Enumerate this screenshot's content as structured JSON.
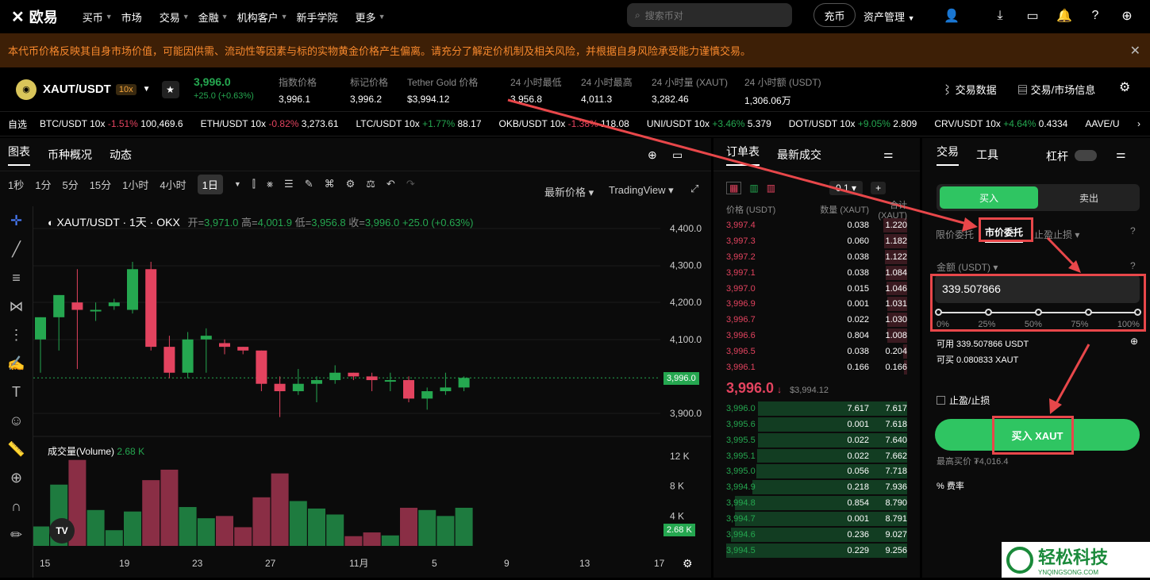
{
  "nav": {
    "logo": "欧易",
    "items": [
      "买币",
      "市场",
      "交易",
      "金融",
      "机构客户",
      "新手学院",
      "更多"
    ],
    "search_placeholder": "搜索币对",
    "deposit": "充币",
    "asset": "资产管理"
  },
  "banner": {
    "text": "本代币价格反映其自身市场价值，可能因供需、流动性等因素与标的实物黄金价格产生偏离。请充分了解定价机制及相关风险，并根据自身风险承受能力谨慎交易。"
  },
  "ticker": {
    "pair": "XAUT/USDT",
    "lev": "10x",
    "price": "3,996.0",
    "change": "+25.0 (+0.63%)",
    "stats": [
      {
        "l": "指数价格",
        "v": "3,996.1"
      },
      {
        "l": "标记价格",
        "v": "3,996.2"
      },
      {
        "l": "Tether Gold 价格",
        "v": "$3,994.12"
      },
      {
        "l": "24 小时最低",
        "v": "3,956.8"
      },
      {
        "l": "24 小时最高",
        "v": "4,011.3"
      },
      {
        "l": "24 小时量 (XAUT)",
        "v": "3,282.46"
      },
      {
        "l": "24 小时额 (USDT)",
        "v": "1,306.06万"
      }
    ],
    "data_btn": "交易数据",
    "info_btn": "交易/市场信息"
  },
  "watch": {
    "label": "自选",
    "items": [
      {
        "p": "BTC/USDT 10x",
        "c": "-1.51%",
        "v": "100,469.6",
        "up": false
      },
      {
        "p": "ETH/USDT 10x",
        "c": "-0.82%",
        "v": "3,273.61",
        "up": false
      },
      {
        "p": "LTC/USDT 10x",
        "c": "+1.77%",
        "v": "88.17",
        "up": true
      },
      {
        "p": "OKB/USDT 10x",
        "c": "-1.38%",
        "v": "118.08",
        "up": false
      },
      {
        "p": "UNI/USDT 10x",
        "c": "+3.46%",
        "v": "5.379",
        "up": true
      },
      {
        "p": "DOT/USDT 10x",
        "c": "+9.05%",
        "v": "2.809",
        "up": true
      },
      {
        "p": "CRV/USDT 10x",
        "c": "+4.64%",
        "v": "0.4334",
        "up": true
      },
      {
        "p": "AAVE/U",
        "c": "",
        "v": "",
        "up": true
      }
    ]
  },
  "chart": {
    "tabs": [
      "图表",
      "币种概况",
      "动态"
    ],
    "tf": [
      "1秒",
      "1分",
      "5分",
      "15分",
      "1小时",
      "4小时",
      "1日"
    ],
    "price_type": "最新价格",
    "view": "TradingView",
    "legend": {
      "title": "XAUT/USDT · 1天 · OKX",
      "o": "3,971.0",
      "h": "4,001.9",
      "l": "3,956.8",
      "c": "3,996.0",
      "ch": "+25.0 (+0.63%)"
    },
    "vol_label": "成交量(Volume)",
    "vol_val": "2.68 K",
    "last_label": "3,996.0",
    "vol_last": "2.68 K"
  },
  "chart_data": {
    "type": "candlestick",
    "title": "XAUT/USDT · 1天 · OKX",
    "y_ticks": [
      "4,400.0",
      "4,300.0",
      "4,200.0",
      "4,100.0",
      "3,900.0"
    ],
    "vol_ticks": [
      "12 K",
      "8 K",
      "4 K"
    ],
    "x_ticks": [
      "15",
      "19",
      "23",
      "27",
      "11月",
      "5",
      "9",
      "13",
      "17"
    ],
    "candles": [
      [
        4100,
        4160,
        4020,
        4010
      ],
      [
        4160,
        4220,
        4110,
        4070
      ],
      [
        4200,
        4180,
        4290,
        4020
      ],
      [
        4180,
        4180,
        4200,
        4150
      ],
      [
        4190,
        4200,
        4210,
        4180
      ],
      [
        4180,
        4290,
        4310,
        4170
      ],
      [
        4290,
        4080,
        4310,
        4070
      ],
      [
        4080,
        4010,
        4110,
        3995
      ],
      [
        4010,
        4100,
        4120,
        3995
      ],
      [
        4100,
        4110,
        4130,
        4010
      ],
      [
        4090,
        4080,
        4100,
        4060
      ],
      [
        4080,
        4070,
        4080,
        4060
      ],
      [
        4070,
        3980,
        4070,
        3960
      ],
      [
        3980,
        3960,
        4000,
        3890
      ],
      [
        3960,
        3980,
        4020,
        3950
      ],
      [
        3980,
        3990,
        4000,
        3930
      ],
      [
        3990,
        4010,
        4030,
        3980
      ],
      [
        4010,
        4000,
        4010,
        3990
      ],
      [
        4000,
        3990,
        4010,
        3960
      ],
      [
        3990,
        3990,
        4010,
        3960
      ],
      [
        3990,
        3940,
        4000,
        3930
      ],
      [
        3940,
        3960,
        3970,
        3910
      ],
      [
        3960,
        3970,
        4010,
        3950
      ],
      [
        3970,
        3996,
        4000,
        3960
      ]
    ],
    "volumes": [
      2600,
      8200,
      11500,
      4800,
      2100,
      4600,
      8800,
      10200,
      5200,
      3700,
      4000,
      2500,
      6500,
      9700,
      6000,
      5000,
      4200,
      1300,
      1800,
      1400,
      5100,
      4800,
      4000,
      5100
    ]
  },
  "orderbook": {
    "tab1": "订单表",
    "tab2": "最新成交",
    "step": "0.1",
    "cols": [
      "价格 (USDT)",
      "数量 (XAUT)",
      "合计 (XAUT)"
    ],
    "asks": [
      [
        "3,997.4",
        "0.038",
        "1.220"
      ],
      [
        "3,997.3",
        "0.060",
        "1.182"
      ],
      [
        "3,997.2",
        "0.038",
        "1.122"
      ],
      [
        "3,997.1",
        "0.038",
        "1.084"
      ],
      [
        "3,997.0",
        "0.015",
        "1.046"
      ],
      [
        "3,996.9",
        "0.001",
        "1.031"
      ],
      [
        "3,996.7",
        "0.022",
        "1.030"
      ],
      [
        "3,996.6",
        "0.804",
        "1.008"
      ],
      [
        "3,996.5",
        "0.038",
        "0.204"
      ],
      [
        "3,996.1",
        "0.166",
        "0.166"
      ]
    ],
    "mid": "3,996.0",
    "mid_sub": "$3,994.12",
    "bids": [
      [
        "3,996.0",
        "7.617",
        "7.617"
      ],
      [
        "3,995.6",
        "0.001",
        "7.618"
      ],
      [
        "3,995.5",
        "0.022",
        "7.640"
      ],
      [
        "3,995.1",
        "0.022",
        "7.662"
      ],
      [
        "3,995.0",
        "0.056",
        "7.718"
      ],
      [
        "3,994.9",
        "0.218",
        "7.936"
      ],
      [
        "3,994.8",
        "0.854",
        "8.790"
      ],
      [
        "3,994.7",
        "0.001",
        "8.791"
      ],
      [
        "3,994.6",
        "0.236",
        "9.027"
      ],
      [
        "3,994.5",
        "0.229",
        "9.256"
      ]
    ]
  },
  "trade": {
    "tab1": "交易",
    "tab2": "工具",
    "lever": "杠杆",
    "buy": "买入",
    "sell": "卖出",
    "types": [
      "限价委托",
      "市价委托",
      "止盈止损"
    ],
    "amount_label": "金额 (USDT)",
    "amount": "339.507866",
    "pcts": [
      "0%",
      "25%",
      "50%",
      "75%",
      "100%"
    ],
    "avail": "可用 339.507866 USDT",
    "canbuy": "可买 0.080833 XAUT",
    "tpsl": "止盈/止损",
    "buy_btn": "买入 XAUT",
    "maxbuy": "最高买价 ₮4,016.4",
    "fee": "费率"
  },
  "watermark": {
    "title": "轻松科技",
    "sub": "YNQINGSONG.COM"
  }
}
